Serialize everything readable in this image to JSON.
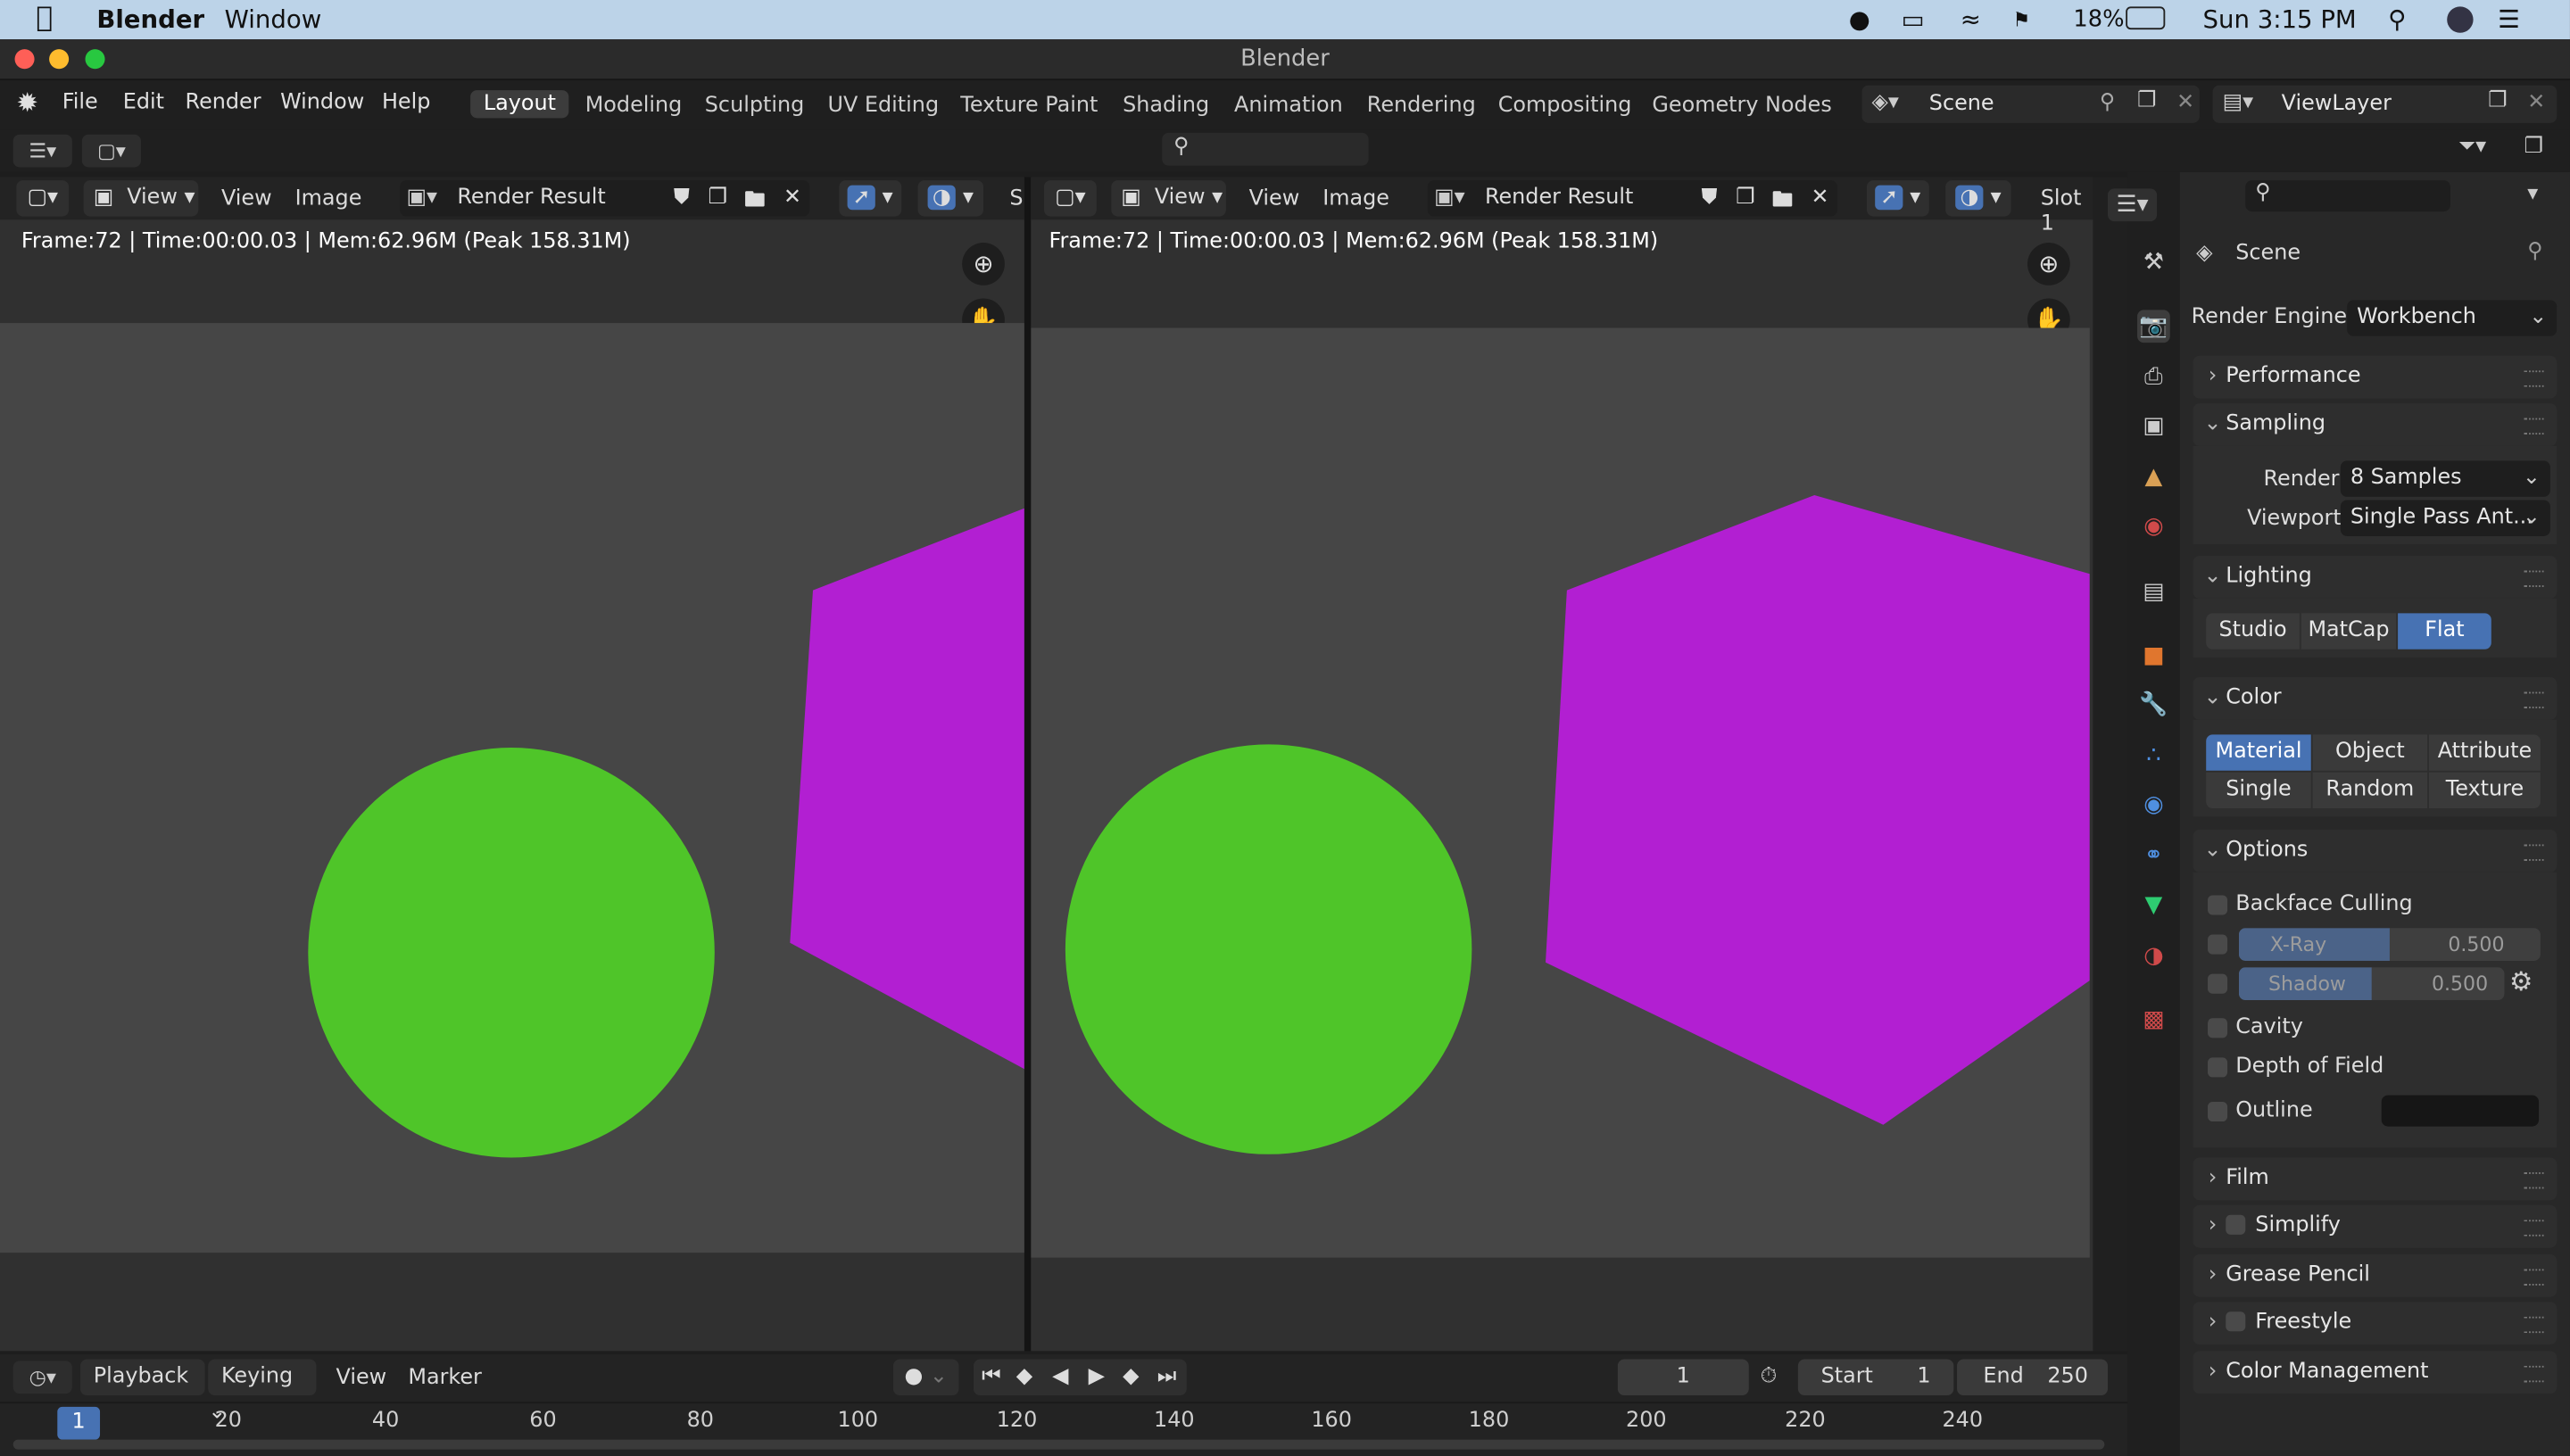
{
  "menubar": {
    "app_name": "Blender",
    "window_menu": "Window",
    "battery": "18%",
    "clock": "Sun 3:15 PM"
  },
  "window": {
    "title": "Blender"
  },
  "topbar": {
    "menus": [
      "File",
      "Edit",
      "Render",
      "Window",
      "Help"
    ],
    "workspaces": [
      "Layout",
      "Modeling",
      "Sculpting",
      "UV Editing",
      "Texture Paint",
      "Shading",
      "Animation",
      "Rendering",
      "Compositing",
      "Geometry Nodes"
    ],
    "active_workspace": "Layout",
    "scene": "Scene",
    "view_layer": "ViewLayer"
  },
  "editor_left": {
    "menus": [
      "View",
      "View",
      "Image"
    ],
    "image_name": "Render Result",
    "slot_truncated": "S",
    "status": "Frame:72 | Time:00:00.03 | Mem:62.96M (Peak 158.31M)"
  },
  "editor_right": {
    "menus": [
      "View",
      "View",
      "Image"
    ],
    "image_name": "Render Result",
    "slot_truncated": "Slot 1",
    "status": "Frame:72 | Time:00:00.03 | Mem:62.96M (Peak 158.31M)"
  },
  "colors": {
    "green": "#4fc529",
    "magenta": "#b21fd2",
    "accent": "#4772b3"
  },
  "properties": {
    "context": "Scene",
    "render_engine_label": "Render Engine",
    "render_engine": "Workbench",
    "panels": {
      "performance": "Performance",
      "sampling": "Sampling",
      "lighting": "Lighting",
      "color": "Color",
      "options": "Options",
      "film": "Film",
      "simplify": "Simplify",
      "grease_pencil": "Grease Pencil",
      "freestyle": "Freestyle",
      "color_management": "Color Management"
    },
    "sampling": {
      "render_label": "Render",
      "render_value": "8 Samples",
      "viewport_label": "Viewport",
      "viewport_value": "Single Pass Ant..."
    },
    "lighting": {
      "options": [
        "Studio",
        "MatCap",
        "Flat"
      ],
      "selected": "Flat"
    },
    "color": {
      "options": [
        "Material",
        "Object",
        "Attribute",
        "Single",
        "Random",
        "Texture"
      ],
      "selected": "Material"
    },
    "options": {
      "backface_culling": "Backface Culling",
      "xray_label": "X-Ray",
      "xray_value": "0.500",
      "shadow_label": "Shadow",
      "shadow_value": "0.500",
      "cavity": "Cavity",
      "depth_of_field": "Depth of Field",
      "outline": "Outline"
    }
  },
  "timeline": {
    "menus": [
      "Playback",
      "Keying",
      "View",
      "Marker"
    ],
    "current_frame": "1",
    "frame_field": "1",
    "start_label": "Start",
    "start_value": "1",
    "end_label": "End",
    "end_value": "250",
    "ticks": [
      "20",
      "40",
      "60",
      "80",
      "100",
      "120",
      "140",
      "160",
      "180",
      "200",
      "220",
      "240"
    ]
  }
}
